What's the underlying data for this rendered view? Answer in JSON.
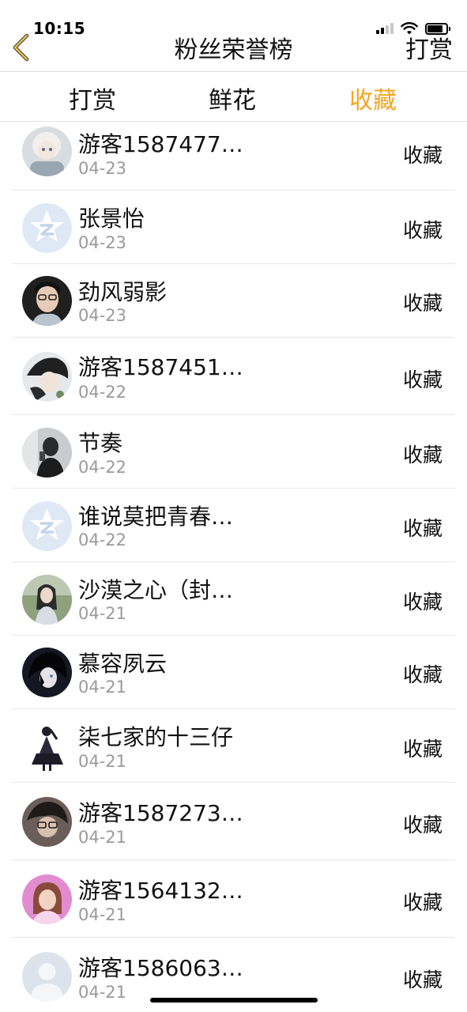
{
  "status_bar": {
    "time": "10:15"
  },
  "nav": {
    "title": "粉丝荣誉榜",
    "right_label": "打赏",
    "back_icon": "chevron-left-icon",
    "accent_color": "#f5a623"
  },
  "tabs": [
    {
      "label": "打赏",
      "active": false
    },
    {
      "label": "鲜花",
      "active": false
    },
    {
      "label": "收藏",
      "active": true
    }
  ],
  "fans": [
    {
      "name": "游客1587477…",
      "date": "04-23",
      "action": "收藏",
      "avatar": "anime-character-avatar"
    },
    {
      "name": "张景怡",
      "date": "04-23",
      "action": "收藏",
      "avatar": "default-qzone-avatar"
    },
    {
      "name": "劲风弱影",
      "date": "04-23",
      "action": "收藏",
      "avatar": "person-glasses-avatar"
    },
    {
      "name": "游客1587451…",
      "date": "04-22",
      "action": "收藏",
      "avatar": "anime-character-avatar"
    },
    {
      "name": "节奏",
      "date": "04-22",
      "action": "收藏",
      "avatar": "person-selfie-avatar"
    },
    {
      "name": "谁说莫把青春…",
      "date": "04-22",
      "action": "收藏",
      "avatar": "default-qzone-avatar"
    },
    {
      "name": "沙漠之心（封…",
      "date": "04-21",
      "action": "收藏",
      "avatar": "person-outdoor-avatar"
    },
    {
      "name": "慕容夙云",
      "date": "04-21",
      "action": "收藏",
      "avatar": "anime-character-avatar"
    },
    {
      "name": "柒七家的十三仔",
      "date": "04-21",
      "action": "收藏",
      "avatar": "anime-figure-avatar"
    },
    {
      "name": "游客1587273…",
      "date": "04-21",
      "action": "收藏",
      "avatar": "anime-character-avatar"
    },
    {
      "name": "游客1564132…",
      "date": "04-21",
      "action": "收藏",
      "avatar": "person-pink-avatar"
    },
    {
      "name": "游客1586063…",
      "date": "04-21",
      "action": "收藏",
      "avatar": "default-user-avatar"
    }
  ]
}
